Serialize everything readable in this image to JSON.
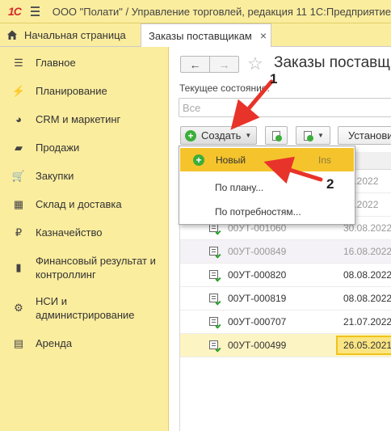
{
  "app": {
    "logo": "1С",
    "title": "ООО \"Полати\" / Управление торговлей, редакция 11 1С:Предприятие"
  },
  "tabs": {
    "home_label": "Начальная страница",
    "orders_label": "Заказы поставщикам",
    "close_glyph": "×"
  },
  "sidebar": {
    "items": [
      {
        "label": "Главное",
        "icon": "list-icon",
        "glyph": "☰"
      },
      {
        "label": "Планирование",
        "icon": "planning-icon",
        "glyph": "⚡"
      },
      {
        "label": "CRM и маркетинг",
        "icon": "pie-chart-icon",
        "glyph": "◕"
      },
      {
        "label": "Продажи",
        "icon": "shopping-bag-icon",
        "glyph": "▰"
      },
      {
        "label": "Закупки",
        "icon": "cart-icon",
        "glyph": "🛒"
      },
      {
        "label": "Склад и доставка",
        "icon": "warehouse-icon",
        "glyph": "▦"
      },
      {
        "label": "Казначейство",
        "icon": "ruble-icon",
        "glyph": "₽"
      },
      {
        "label": "Финансовый результат и контроллинг",
        "icon": "bar-chart-icon",
        "glyph": "▮"
      },
      {
        "label": "НСИ и администрирование",
        "icon": "gear-icon",
        "glyph": "⚙"
      },
      {
        "label": "Аренда",
        "icon": "rent-icon",
        "glyph": "▤"
      }
    ]
  },
  "main": {
    "nav_back": "←",
    "nav_forward": "→",
    "star": "☆",
    "title": "Заказы поставщи",
    "state_label": "Текущее состояние:",
    "state_placeholder": "Все",
    "create_label": "Создать",
    "caret": "▼",
    "set_label": "Установи",
    "date_col_label": "та"
  },
  "dropdown": {
    "items": [
      {
        "label": "Новый",
        "shortcut": "Ins"
      },
      {
        "label": "По плану..."
      },
      {
        "label": "По потребностям..."
      }
    ]
  },
  "table": {
    "rows": [
      {
        "number": "",
        "date": "09.2022"
      },
      {
        "number": "",
        "date": "09.2022"
      },
      {
        "number": "00УТ-001060",
        "date": "30.08.2022"
      },
      {
        "number": "00УТ-000849",
        "date": "16.08.2022"
      },
      {
        "number": "00УТ-000820",
        "date": "08.08.2022"
      },
      {
        "number": "00УТ-000819",
        "date": "08.08.2022"
      },
      {
        "number": "00УТ-000707",
        "date": "21.07.2022"
      },
      {
        "number": "00УТ-000499",
        "date": "26.05.2021"
      }
    ]
  },
  "annotations": {
    "callout_1": "1",
    "callout_2": "2",
    "arrow_color": "#e8332a"
  }
}
